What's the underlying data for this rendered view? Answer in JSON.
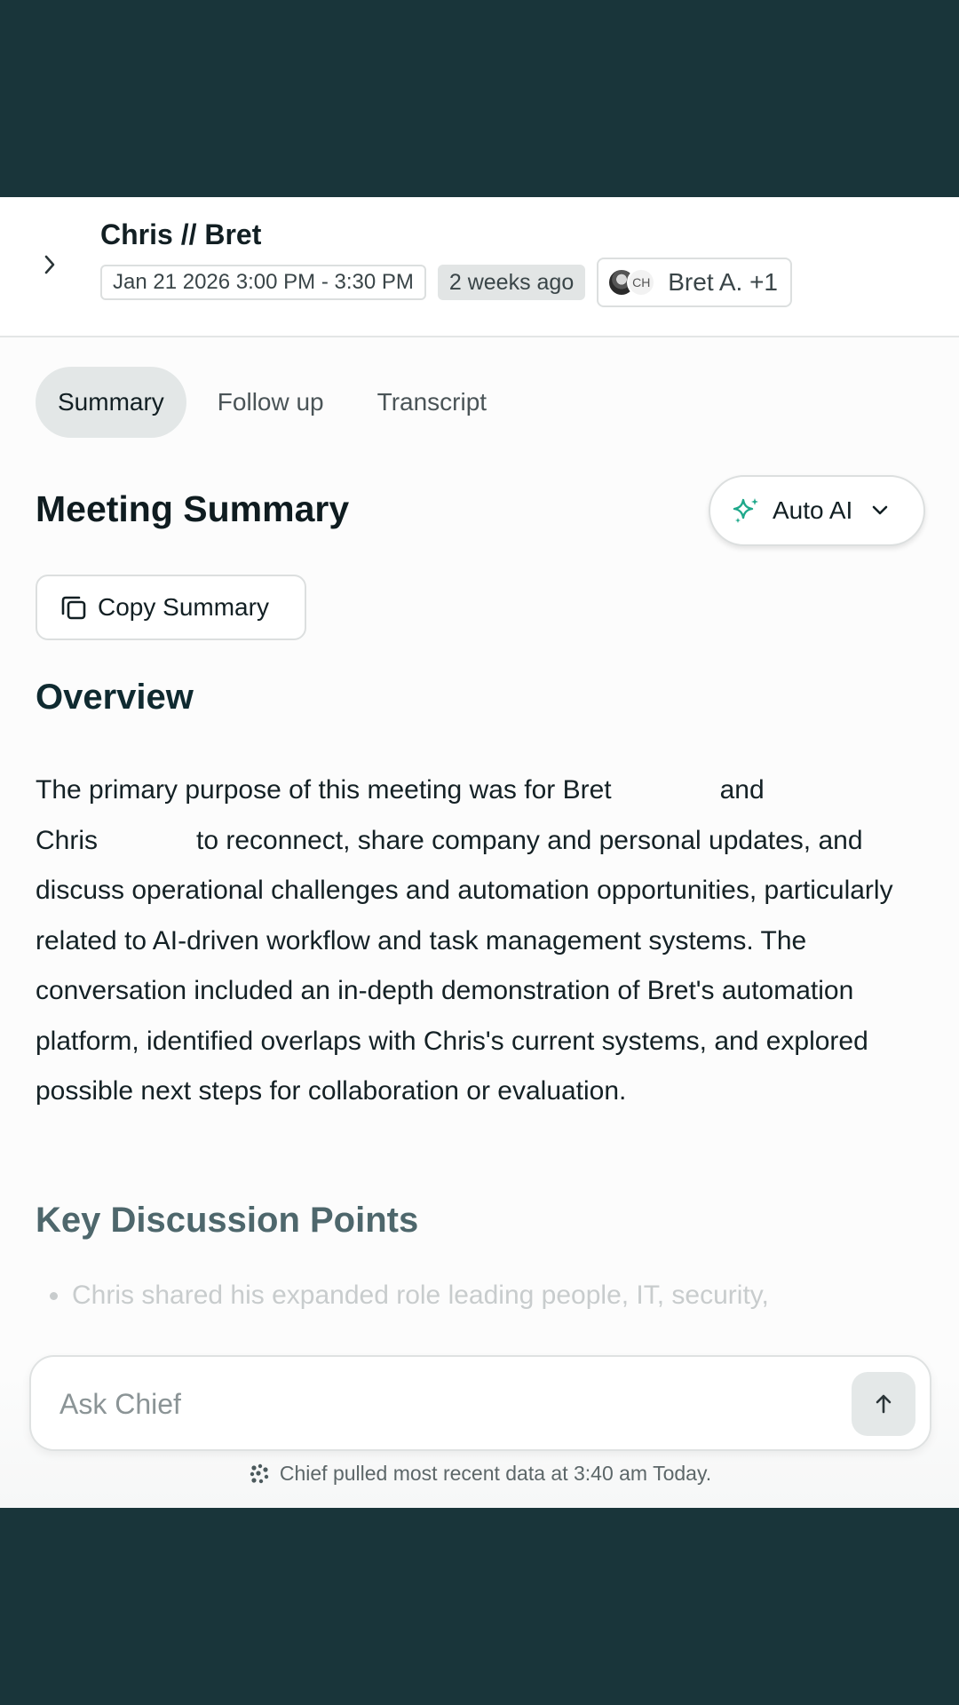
{
  "header": {
    "title": "Chris // Bret",
    "date_range": "Jan 21 2026 3:00 PM - 3:30 PM",
    "relative_time": "2 weeks ago",
    "avatar_initials": "CH",
    "attendees": "Bret A. +1"
  },
  "tabs": [
    {
      "label": "Summary",
      "active": true
    },
    {
      "label": "Follow up",
      "active": false
    },
    {
      "label": "Transcript",
      "active": false
    }
  ],
  "summary": {
    "title": "Meeting Summary",
    "model_select": "Auto AI",
    "copy_label": "Copy Summary"
  },
  "overview": {
    "title": "Overview",
    "text_part1": "The primary purpose of this meeting was for Bret",
    "text_part2": "and",
    "text_part3": "Chris",
    "text_part4": "to reconnect, share company and personal updates, and discuss operational challenges and automation opportunities, particularly related to AI-driven workflow and task management systems. The conversation included an in-depth demonstration of Bret's automation platform, identified overlaps with Chris's current systems, and explored possible next steps for collaboration or evaluation."
  },
  "key_points": {
    "title": "Key Discussion Points",
    "items": [
      "Chris shared his expanded role leading people, IT, security,"
    ]
  },
  "ask": {
    "placeholder": "Ask Chief",
    "status": "Chief pulled most recent data at 3:40 am Today."
  },
  "icons": {
    "collapse": "chevron-right-icon",
    "sparkle": "sparkle-icon",
    "dropdown": "chevron-down-icon",
    "copy": "copy-icon",
    "send": "arrow-up-icon",
    "chief": "chief-logo-icon"
  },
  "colors": {
    "frame": "#19353a",
    "accent": "#1ea88a",
    "heading": "#0f2a30"
  }
}
